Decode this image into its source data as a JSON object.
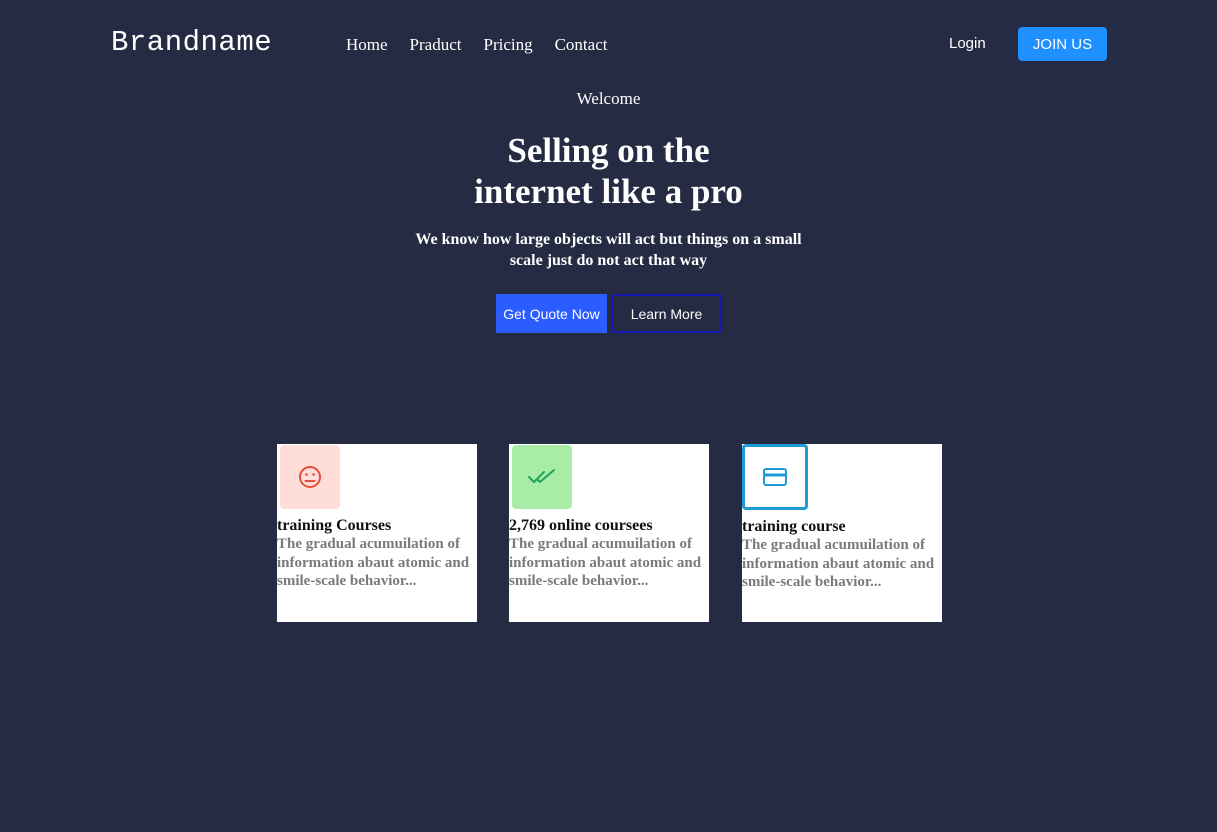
{
  "header": {
    "brand": "Brandname",
    "nav": [
      "Home",
      "Praduct",
      "Pricing",
      "Contact"
    ],
    "login": "Login",
    "join": "JOIN US"
  },
  "hero": {
    "welcome": "Welcome",
    "title_line1": "Selling on the",
    "title_line2": "internet like a pro",
    "subtitle": "We know how large objects will act but things on a small scale just do not act that way",
    "primary_button": "Get Quote Now",
    "secondary_button": "Learn More"
  },
  "cards": [
    {
      "icon": "sad-face-icon",
      "icon_bg": "#ffded9",
      "icon_color": "#e74c3c",
      "title": "training Courses",
      "text": "The gradual acumuilation of information abaut atomic and smile-scale behavior..."
    },
    {
      "icon": "double-check-icon",
      "icon_bg": "#a8eca8",
      "icon_color": "#23a35a",
      "title": "2,769 online coursees",
      "text": "The gradual acumuilation of information abaut atomic and smile-scale behavior..."
    },
    {
      "icon": "credit-card-icon",
      "icon_bg": "#ffffff",
      "icon_border": "#1e9bd7",
      "icon_color": "#1e9bd7",
      "title": "training course",
      "text": "The gradual acumuilation of information abaut atomic and smile-scale behavior..."
    }
  ],
  "colors": {
    "background": "#252b42",
    "join_button": "#1e90ff",
    "quote_button": "#2b5cff",
    "learn_border": "#1717b8"
  }
}
